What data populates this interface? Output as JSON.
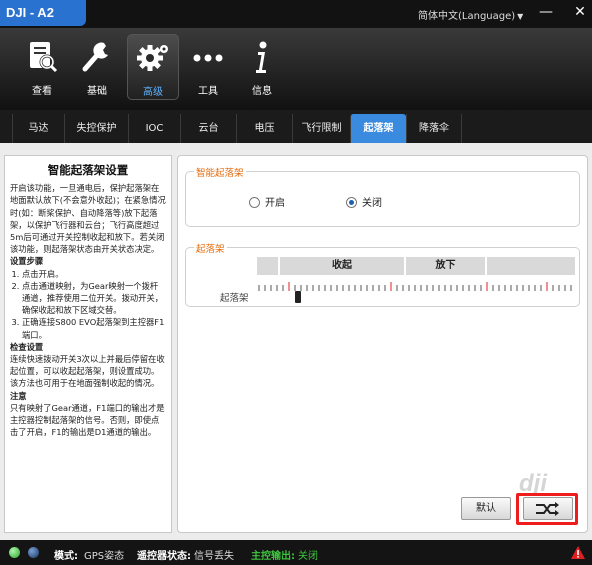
{
  "window": {
    "title": "DJI - A2",
    "language": "简体中文(Language)",
    "minimize": "—",
    "close": "✕"
  },
  "toolbar": [
    {
      "label": "查看",
      "icon": "view-icon"
    },
    {
      "label": "基础",
      "icon": "wrench-icon"
    },
    {
      "label": "高级",
      "icon": "gear-icon",
      "active": true
    },
    {
      "label": "工具",
      "icon": "more-dots-icon"
    },
    {
      "label": "信息",
      "icon": "info-icon"
    }
  ],
  "tabs": [
    "马达",
    "失控保护",
    "IOC",
    "云台",
    "电压",
    "飞行限制",
    "起落架",
    "降落伞"
  ],
  "active_tab": "起落架",
  "help": {
    "title": "智能起落架设置",
    "intro": "开启该功能，一旦通电后，保护起落架在地面默认放下(不会意外收起)；在紧急情况时(如：断桨保护、自动降落等)放下起落架，以保护飞行器和云台；飞行高度超过5m后可通过开关控制收起和放下。若关闭该功能，则起落架状态由开关状态决定。",
    "steps_title": "设置步骤",
    "steps": [
      "点击开启。",
      "点击通道映射，为Gear映射一个拨杆通道，推荐使用二位开关。拨动开关，确保收起和放下区域交替。",
      "正确连接S800 EVO起落架到主控器F1端口。"
    ],
    "check_title": "检查设置",
    "check": "连续快速拨动开关3次以上并最后停留在收起位置，可以收起起落架，则设置成功。该方法也可用于在地面强制收起的情况。",
    "note_title": "注意",
    "note": "只有映射了Gear通道，F1端口的输出才是主控器控制起落架的信号。否则，即使点击了开启，F1的输出是D1通道的输出。"
  },
  "smart_gear": {
    "title": "智能起落架",
    "option_on": "开启",
    "option_off": "关闭",
    "selected": "关闭"
  },
  "landing_gear": {
    "title": "起落架",
    "retract": "收起",
    "lower": "放下",
    "channel_label": "起落架",
    "slider_value": 0.13
  },
  "buttons": {
    "default": "默认",
    "apply_icon": "swap-arrows-icon"
  },
  "watermark": "dji",
  "status": {
    "mode_label": "模式:",
    "mode_value": "GPS姿态",
    "rc_label": "遥控器状态:",
    "rc_value": "信号丢失",
    "output_label": "主控输出:",
    "output_value": "关闭"
  },
  "colors": {
    "accent": "#3a8be0",
    "group_title": "#e36b0e",
    "highlight": "#ee1c1c",
    "status_green": "#3ec43e"
  }
}
